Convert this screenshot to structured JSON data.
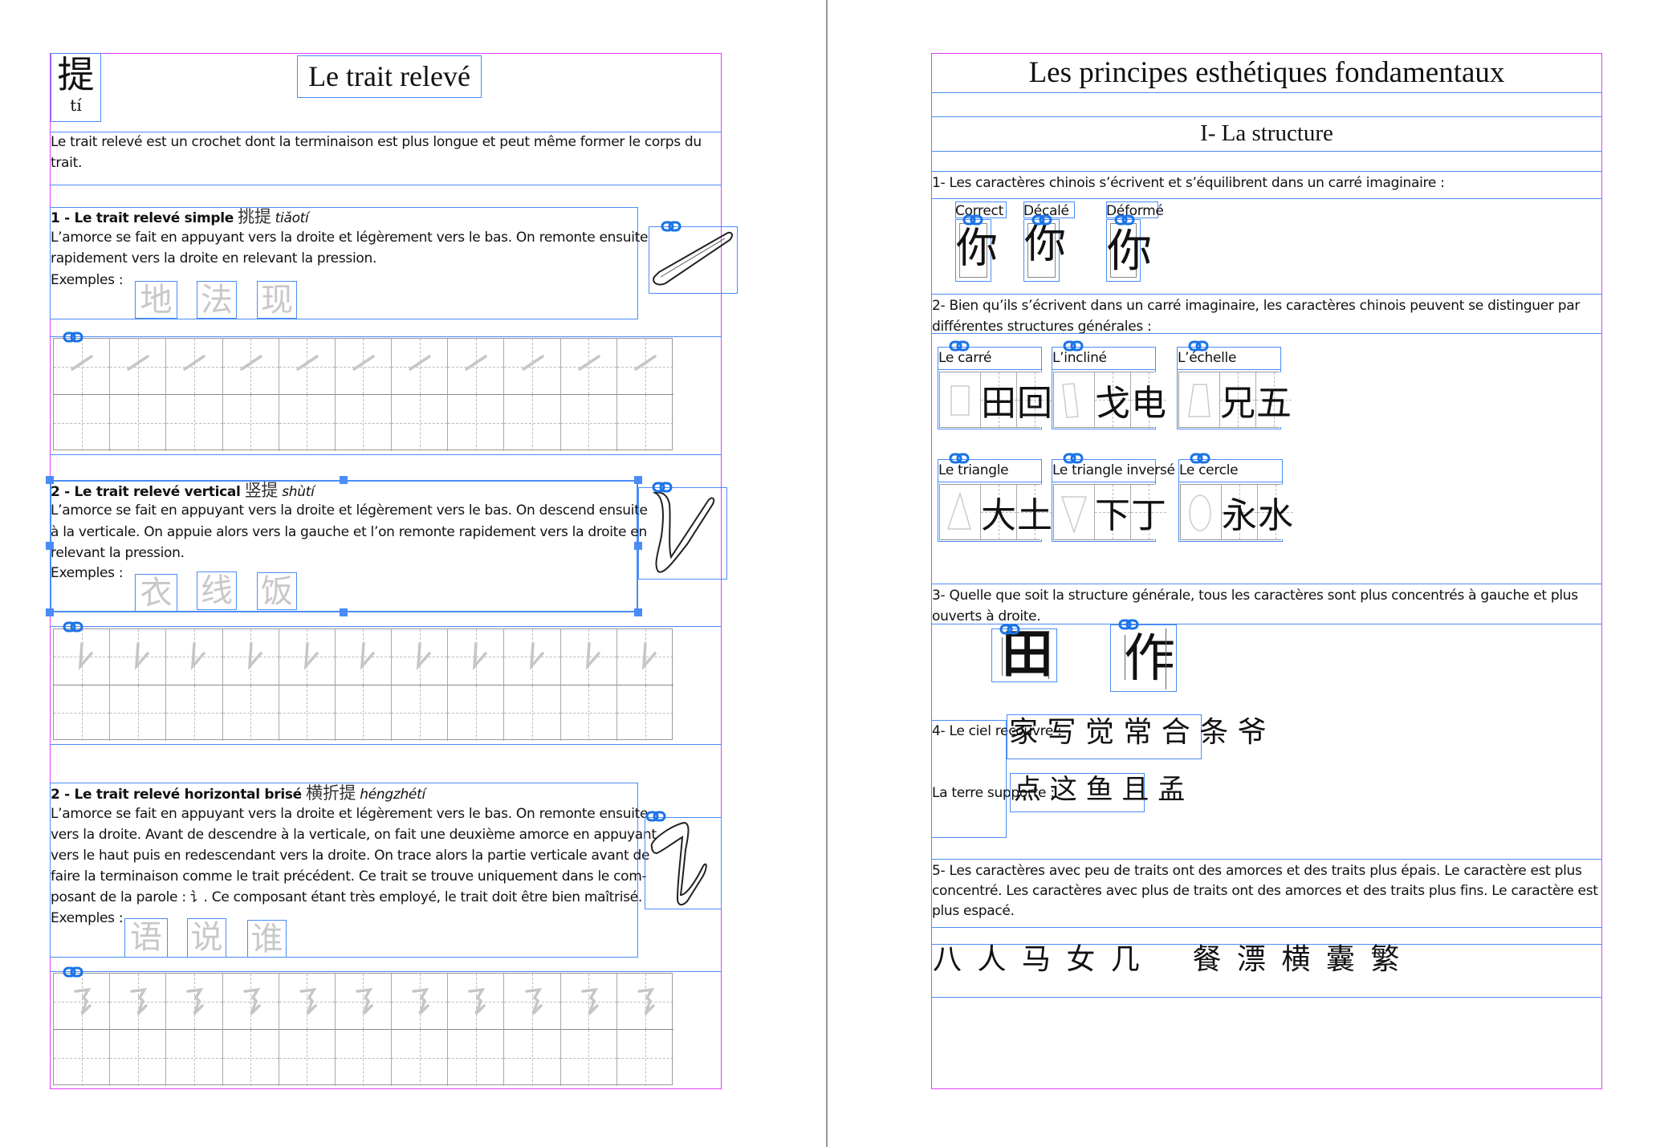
{
  "left_page": {
    "hanzi": "提",
    "pinyin": "tí",
    "title": "Le trait relevé",
    "intro_lines": [
      "Le trait relevé est un crochet dont la terminaison est plus longue et peut même former le corps du",
      "trait."
    ],
    "sections": [
      {
        "heading": "1 - Le trait relevé simple",
        "hanzi": "挑提",
        "pinyin": "tiǎotí",
        "lines": [
          "L’amorce se fait en appuyant vers la droite et légèrement vers le bas. On remonte ensuite",
          "rapidement vers la droite en relevant la pression."
        ],
        "examples_label": "Exemples :",
        "examples": [
          "地",
          "法",
          "现"
        ]
      },
      {
        "heading": "2 - Le trait relevé vertical",
        "hanzi": "竖提",
        "pinyin": "shùtí",
        "lines": [
          "L’amorce se fait en appuyant vers la droite et légèrement vers le bas. On descend ensuite",
          "à la verticale. On appuie alors vers la gauche et l’on remonte rapidement vers la droite en",
          "relevant la pression."
        ],
        "examples_label": "Exemples :",
        "examples": [
          "衣",
          "线",
          "饭"
        ]
      },
      {
        "heading": "2 - Le trait relevé horizontal brisé",
        "hanzi": "横折提",
        "pinyin": "héngzhétí",
        "lines": [
          "L’amorce se fait en appuyant vers la droite et légèrement vers le bas. On remonte ensuite",
          "vers la droite. Avant de descendre à la verticale, on fait une deuxième amorce en appuyant",
          "vers le haut puis en redescendant vers la droite. On trace alors la partie verticale avant de",
          "faire la terminaison comme le trait précédent. Ce trait se trouve uniquement dans le com-",
          "posant de la parole : 讠.  Ce composant étant très employé, le trait doit être bien maîtrisé."
        ],
        "examples_label": "Exemples :",
        "examples": [
          "语",
          "说",
          "谁"
        ]
      }
    ]
  },
  "right_page": {
    "title": "Les principes esthétiques fondamentaux",
    "subtitle": "I- La structure",
    "item1": "1- Les caractères chinois s’écrivent et s’équilibrent dans un carré imaginaire :",
    "variants": [
      {
        "label": "Correct",
        "char": "你"
      },
      {
        "label": "Décalé",
        "char": "你"
      },
      {
        "label": "Déformé",
        "char": "你"
      }
    ],
    "item2_lines": [
      "2- Bien qu’ils s’écrivent dans un carré imaginaire, les caractères chinois peuvent se distinguer par",
      "différentes structures générales  :"
    ],
    "structures": [
      {
        "label": "Le carré",
        "shape": "square",
        "chars": [
          "田",
          "回"
        ]
      },
      {
        "label": "L’incliné",
        "shape": "slanted-rectangle",
        "chars": [
          "戈",
          "电"
        ]
      },
      {
        "label": "L’échelle",
        "shape": "trapezoid",
        "chars": [
          "兄",
          "五"
        ]
      },
      {
        "label": "Le triangle",
        "shape": "triangle",
        "chars": [
          "大",
          "土"
        ]
      },
      {
        "label": "Le triangle inversé",
        "shape": "inverted-triangle",
        "chars": [
          "下",
          "丁"
        ]
      },
      {
        "label": "Le cercle",
        "shape": "circle",
        "chars": [
          "永",
          "水"
        ]
      }
    ],
    "item3_lines": [
      "3- Quelle que soit la structure générale, tous les caractères sont plus concentrés à gauche et plus",
      "ouverts à droite."
    ],
    "item3_chars": [
      "田",
      "作"
    ],
    "item4_label_sky": "4- Le ciel recouvre :",
    "item4_sky_chars": "家 写 觉 常 合 条 爷",
    "item4_label_earth": "La  terre supporte :",
    "item4_earth_chars": "点 这 鱼 且 孟",
    "item5_lines": [
      "5- Les caractères avec peu de traits ont des amorces et des traits plus épais. Le caractère est plus",
      "concentré.  Les caractères avec plus de traits ont des amorces et des traits plus fins. Le caractère est",
      "plus espacé."
    ],
    "item5_chars": "八 人 马 女 几    餐 漂 横 囊 繁"
  },
  "colors": {
    "frame": "#e040fb",
    "guide": "#4a8cf7",
    "example_gray": "#c8c8c8"
  }
}
